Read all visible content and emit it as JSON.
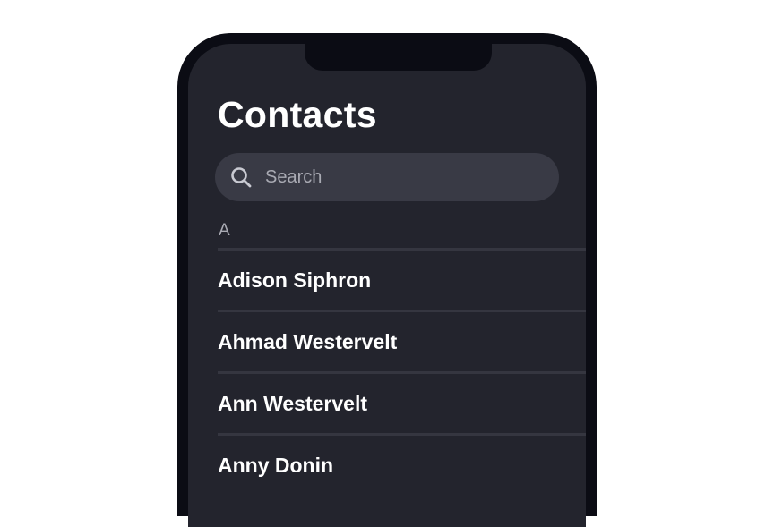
{
  "header": {
    "title": "Contacts"
  },
  "search": {
    "placeholder": "Search",
    "icon": "search-icon"
  },
  "sections": [
    {
      "letter": "A",
      "contacts": [
        {
          "name": "Adison Siphron"
        },
        {
          "name": "Ahmad Westervelt"
        },
        {
          "name": "Ann Westervelt"
        },
        {
          "name": "Anny Donin"
        }
      ]
    }
  ],
  "colors": {
    "phone_frame": "#0b0c14",
    "screen_background": "#23242d",
    "search_background": "#393a45",
    "divider": "#353640",
    "text_primary": "#ffffff",
    "text_secondary": "#a9aab3"
  }
}
